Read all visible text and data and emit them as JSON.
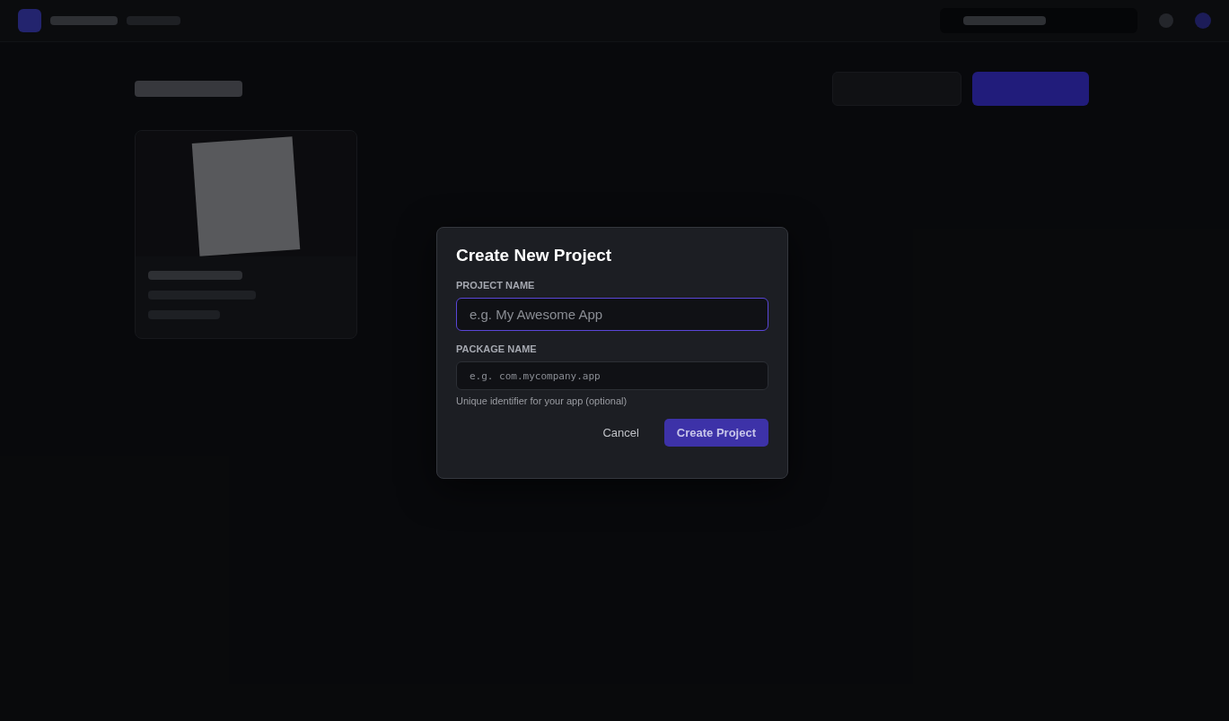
{
  "dialog": {
    "title": "Create New Project",
    "fields": [
      {
        "label": "PROJECT NAME",
        "placeholder": "e.g. My Awesome App",
        "focused": true,
        "kind": "text"
      },
      {
        "label": "PACKAGE NAME",
        "placeholder": "e.g. com.mycompany.app",
        "focused": false,
        "kind": "mono",
        "hint": "Unique identifier for your app (optional)"
      }
    ],
    "buttons": [
      {
        "label": "Cancel",
        "kind": "secondary"
      },
      {
        "label": "Create Project",
        "kind": "primary"
      }
    ]
  }
}
